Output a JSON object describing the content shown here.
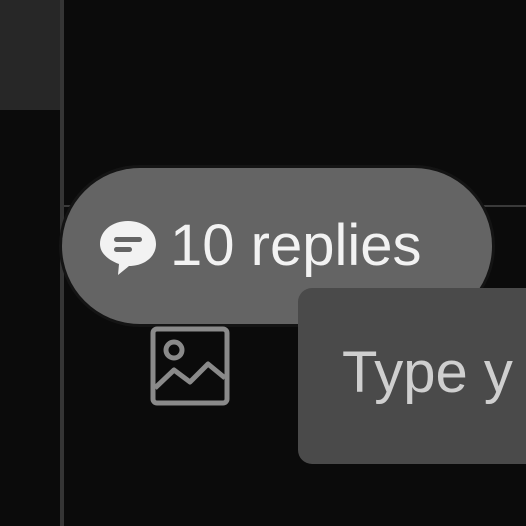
{
  "thread": {
    "replies_label": "10 replies",
    "replies_icon": "chat-bubble-icon"
  },
  "composer": {
    "image_icon": "image-icon",
    "placeholder": "Type y"
  },
  "colors": {
    "background": "#0b0b0b",
    "pill": "#646464",
    "input": "#4a4a4a",
    "text": "#f2f2f2"
  }
}
